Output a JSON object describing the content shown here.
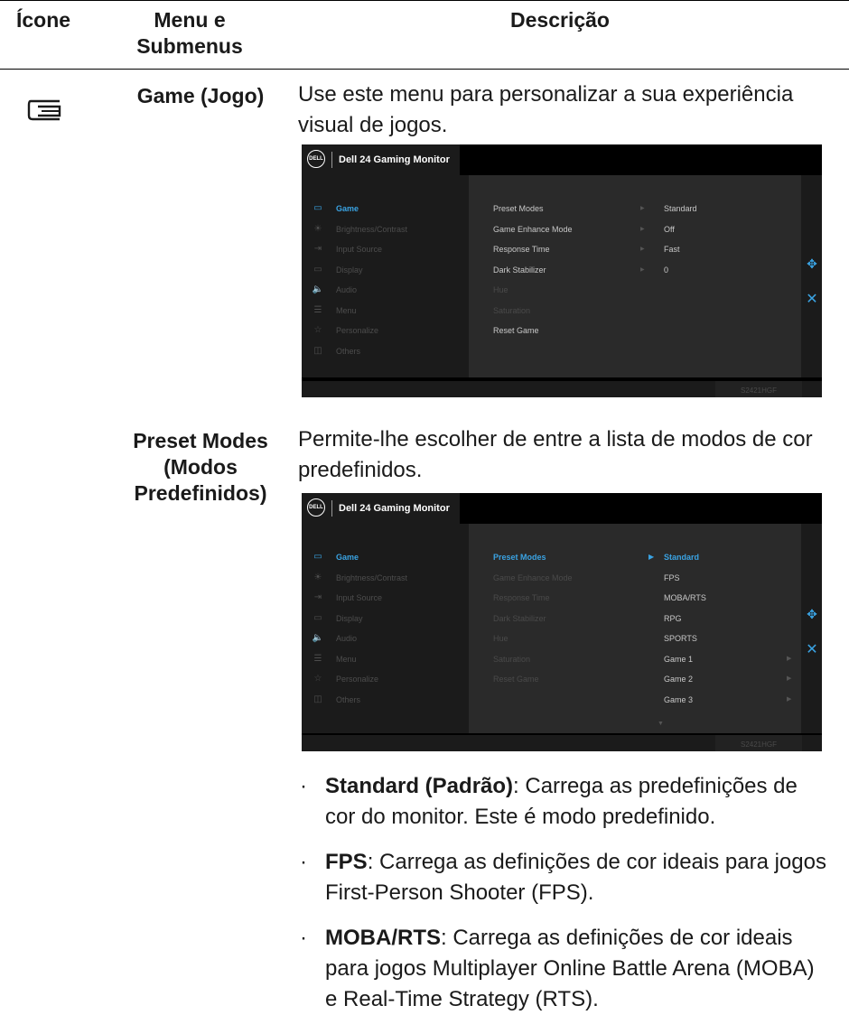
{
  "header": {
    "col_icon": "Ícone",
    "col_menu": "Menu e Submenus",
    "col_desc": "Descrição"
  },
  "row_game": {
    "submenu": "Game (Jogo)",
    "icon": "game-controller-icon",
    "description": "Use este menu para personalizar a sua experiência visual de jogos."
  },
  "row_preset": {
    "submenu": "Preset Modes (Modos Predefinidos)",
    "description": "Permite-lhe escolher de entre a lista de modos de cor predefinidos."
  },
  "osd": {
    "title": "Dell 24 Gaming Monitor",
    "logo": "DELL",
    "model": "S2421HGF",
    "menu": [
      "Game",
      "Brightness/Contrast",
      "Input Source",
      "Display",
      "Audio",
      "Menu",
      "Personalize",
      "Others"
    ],
    "menu_icons": [
      "game-icon",
      "brightness-icon",
      "input-source-icon",
      "display-icon",
      "audio-icon",
      "menu-icon",
      "star-icon",
      "others-icon"
    ],
    "game_settings": [
      "Preset Modes",
      "Game Enhance Mode",
      "Response Time",
      "Dark Stabilizer",
      "Hue",
      "Saturation",
      "Reset Game"
    ],
    "game_values": [
      "Standard",
      "Off",
      "Fast",
      "0"
    ],
    "preset_options": [
      "Standard",
      "FPS",
      "MOBA/RTS",
      "RPG",
      "SPORTS",
      "Game 1",
      "Game 2",
      "Game 3"
    ]
  },
  "bullets": [
    {
      "term": "Standard (Padrão)",
      "text": ": Carrega as predefinições de cor do monitor. Este é modo predefinido."
    },
    {
      "term": "FPS",
      "text": ": Carrega as definições de cor ideais para jogos First-Person Shooter (FPS)."
    },
    {
      "term": "MOBA/RTS",
      "text": ": Carrega as definições de cor ideais para jogos Multiplayer Online Battle Arena (MOBA) e Real-Time Strategy (RTS)."
    }
  ],
  "colors": {
    "accent": "#3aa3e3",
    "osd_bg": "#000000",
    "osd_panel": "#1b1b1b",
    "osd_mid": "#2a2a2a"
  }
}
